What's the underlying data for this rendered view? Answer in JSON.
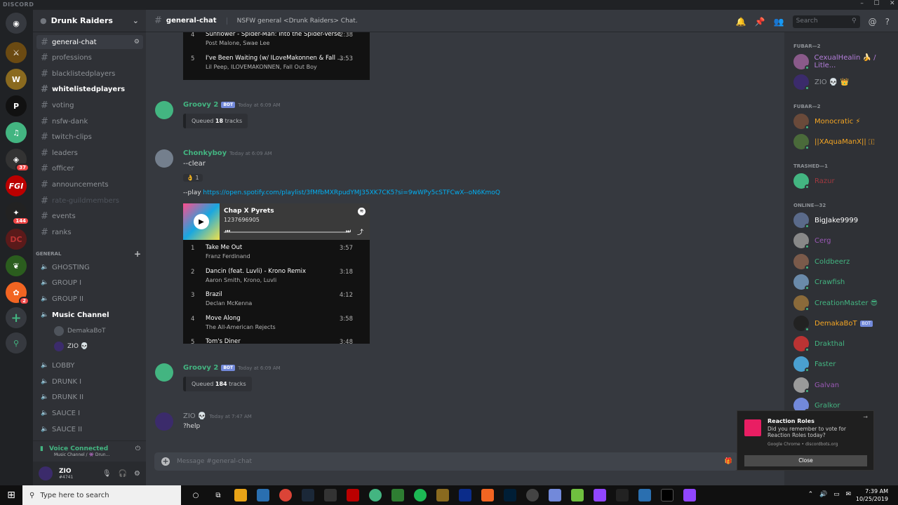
{
  "app": {
    "title": "DISCORD"
  },
  "server": {
    "name": "Drunk Raiders"
  },
  "channels": [
    {
      "name": "general-chat",
      "state": "selected"
    },
    {
      "name": "professions",
      "state": "normal"
    },
    {
      "name": "blacklistedplayers",
      "state": "normal"
    },
    {
      "name": "whitelistedplayers",
      "state": "bright"
    },
    {
      "name": "voting",
      "state": "normal"
    },
    {
      "name": "nsfw-dank",
      "state": "normal"
    },
    {
      "name": "twitch-clips",
      "state": "normal"
    },
    {
      "name": "leaders",
      "state": "normal"
    },
    {
      "name": "officer",
      "state": "normal"
    },
    {
      "name": "announcements",
      "state": "normal"
    },
    {
      "name": "rate-guildmembers",
      "state": "dim"
    },
    {
      "name": "events",
      "state": "normal"
    },
    {
      "name": "ranks",
      "state": "normal"
    }
  ],
  "category": {
    "name": "GENERAL"
  },
  "voice_channels": [
    {
      "name": "GHOSTING",
      "bright": false
    },
    {
      "name": "GROUP I",
      "bright": false
    },
    {
      "name": "GROUP II",
      "bright": false
    },
    {
      "name": "Music Channel",
      "bright": true
    },
    {
      "name": "LOBBY",
      "bright": false
    },
    {
      "name": "DRUNK I",
      "bright": false
    },
    {
      "name": "DRUNK II",
      "bright": false
    },
    {
      "name": "SAUCE I",
      "bright": false
    },
    {
      "name": "SAUCE II",
      "bright": false
    }
  ],
  "voice_users": [
    "DemakaBoT",
    "ZIO 💀"
  ],
  "voice_status": {
    "label": "Voice Connected",
    "sub": "Music Channel / 👾 Drun..."
  },
  "user": {
    "name": "ZIO",
    "tag": "#4741"
  },
  "header": {
    "channel": "general-chat",
    "topic": "NSFW general <Drunk Raiders> Chat.",
    "search_placeholder": "Search"
  },
  "top_tracks": [
    {
      "n": "4",
      "title": "Sunflower - Spider-Man: Into the Spider-Verse",
      "artist": "Post Malone, Swae Lee",
      "dur": "2:38"
    },
    {
      "n": "5",
      "title": "I've Been Waiting (w/ ILoveMakonnen & Fall ...",
      "artist": "Lil Peep, ILOVEMAKONNEN, Fall Out Boy",
      "dur": "3:53"
    }
  ],
  "messages": {
    "m1": {
      "author": "Groovy 2",
      "bot": "BOT",
      "time": "Today at 6:09 AM",
      "queued_pre": "Queued ",
      "queued_num": "18",
      "queued_post": " tracks"
    },
    "m2": {
      "author": "Chonkyboy",
      "time": "Today at 6:09 AM",
      "line1": "--clear",
      "reaction": "👌 1",
      "play_prefix": "--play ",
      "link": "https://open.spotify.com/playlist/3fMfbMXRpudYMJ35XK7CK5?si=9wWPy5cSTFCwX--oN6KmoQ"
    },
    "m3": {
      "author": "Groovy 2",
      "bot": "BOT",
      "time": "Today at 6:09 AM",
      "queued_pre": "Queued ",
      "queued_num": "184",
      "queued_post": " tracks"
    },
    "m4": {
      "author": "ZIO 💀",
      "time": "Today at 7:47 AM",
      "text": "?help"
    }
  },
  "card": {
    "title": "Chap X Pyrets",
    "subtitle": "1237696905"
  },
  "card_tracks": [
    {
      "n": "1",
      "title": "Take Me Out",
      "artist": "Franz Ferdinand",
      "dur": "3:57"
    },
    {
      "n": "2",
      "title": "Dancin (feat. Luvli) - Krono Remix",
      "artist": "Aaron Smith, Krono, Luvli",
      "dur": "3:18"
    },
    {
      "n": "3",
      "title": "Brazil",
      "artist": "Declan McKenna",
      "dur": "4:12"
    },
    {
      "n": "4",
      "title": "Move Along",
      "artist": "The All-American Rejects",
      "dur": "3:58"
    },
    {
      "n": "5",
      "title": "Tom's Diner",
      "artist": "",
      "dur": "3:48"
    }
  ],
  "input": {
    "placeholder": "Message #general-chat"
  },
  "member_cats": [
    {
      "name": "FUBAR—2"
    },
    {
      "name": "FUBAR—2"
    },
    {
      "name": "TRASHED—1"
    },
    {
      "name": "ONLINE—32"
    }
  ],
  "members": [
    {
      "name": "CexualHealin 🍌 / Litle...",
      "color": "#b57edc"
    },
    {
      "name": "ZIO 💀 👑",
      "color": "#8e9297"
    },
    {
      "name": "Monocratic ⚡",
      "color": "#f5a623"
    },
    {
      "name": "||XAquaManX|| 🇮",
      "color": "#f5a623"
    },
    {
      "name": "Razur",
      "color": "#a0393f"
    },
    {
      "name": "BigJake9999",
      "color": "#ffffff"
    },
    {
      "name": "Cerg",
      "color": "#9b59b6"
    },
    {
      "name": "Coldbeerz",
      "color": "#43b581"
    },
    {
      "name": "Crawfish",
      "color": "#43b581"
    },
    {
      "name": "CreationMaster 😎",
      "color": "#43b581"
    },
    {
      "name": "DemakaBoT",
      "color": "#f5a623",
      "bot": "BOT"
    },
    {
      "name": "Drakthal",
      "color": "#43b581"
    },
    {
      "name": "Faster",
      "color": "#43b581"
    },
    {
      "name": "Galvan",
      "color": "#9b59b6"
    },
    {
      "name": "Gralkor",
      "color": "#43b581"
    }
  ],
  "toast": {
    "title": "Reaction Roles",
    "body": "Did you remember to vote for Reaction Roles today?",
    "source": "Google Chrome • discordbots.org",
    "button": "Close"
  },
  "taskbar": {
    "search": "Type here to search",
    "time": "7:39 AM",
    "date": "10/25/2019"
  },
  "colors": {
    "accent": "#7289da",
    "online": "#43b581",
    "bg": "#36393f"
  }
}
